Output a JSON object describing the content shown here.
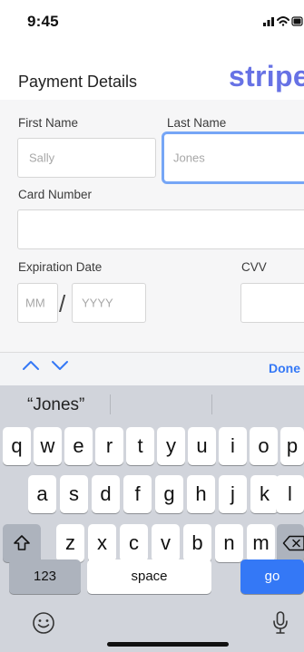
{
  "status_bar": {
    "time": "9:45",
    "icons": [
      "cellular-signal-icon",
      "wifi-icon",
      "battery-icon"
    ]
  },
  "header": {
    "title": "Payment Details",
    "brand": "stripe",
    "brand_color": "#6772e5"
  },
  "form": {
    "first_name": {
      "label": "First Name",
      "placeholder": "Sally",
      "value": ""
    },
    "last_name": {
      "label": "Last Name",
      "placeholder": "Jones",
      "value": "",
      "focused": true
    },
    "card_number": {
      "label": "Card Number",
      "placeholder": "",
      "value": ""
    },
    "expiration": {
      "label": "Expiration Date",
      "month_placeholder": "MM",
      "separator": "/",
      "year_placeholder": "YYYY"
    },
    "cvv": {
      "label": "CVV",
      "placeholder": "",
      "value": ""
    }
  },
  "keyboard": {
    "accessory": {
      "prev_icon": "chevron-up-icon",
      "next_icon": "chevron-down-icon",
      "done_label": "Done"
    },
    "suggestion": "“Jones”",
    "row1": [
      "q",
      "w",
      "e",
      "r",
      "t",
      "y",
      "u",
      "i",
      "o",
      "p"
    ],
    "row2": [
      "a",
      "s",
      "d",
      "f",
      "g",
      "h",
      "j",
      "k",
      "l"
    ],
    "row3": [
      "z",
      "x",
      "c",
      "v",
      "b",
      "n",
      "m"
    ],
    "numbers_label": "123",
    "space_label": "space",
    "go_label": "go",
    "icons": [
      "shift-icon",
      "delete-icon",
      "emoji-icon",
      "microphone-icon"
    ],
    "accent_color": "#3478f6"
  }
}
